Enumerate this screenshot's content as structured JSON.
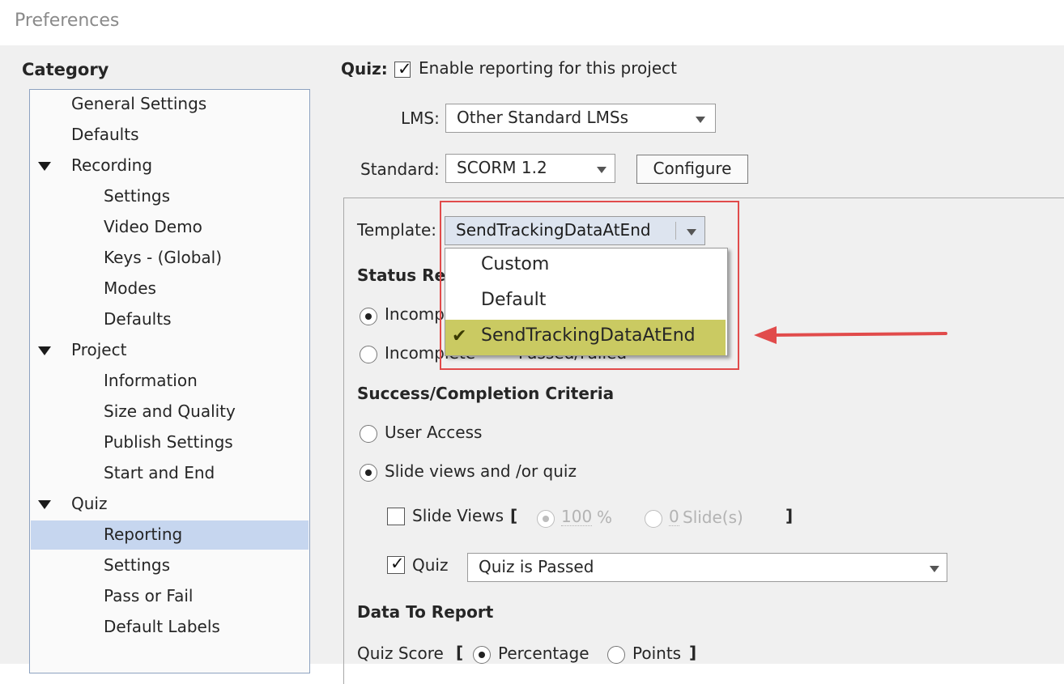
{
  "window": {
    "title": "Preferences"
  },
  "category": {
    "heading": "Category",
    "items": [
      {
        "label": "General Settings",
        "level": 0,
        "expandable": false,
        "selected": false
      },
      {
        "label": "Defaults",
        "level": 0,
        "expandable": false,
        "selected": false
      },
      {
        "label": "Recording",
        "level": 0,
        "expandable": true,
        "selected": false
      },
      {
        "label": "Settings",
        "level": 1,
        "expandable": false,
        "selected": false
      },
      {
        "label": "Video Demo",
        "level": 1,
        "expandable": false,
        "selected": false
      },
      {
        "label": "Keys - (Global)",
        "level": 1,
        "expandable": false,
        "selected": false
      },
      {
        "label": "Modes",
        "level": 1,
        "expandable": false,
        "selected": false
      },
      {
        "label": "Defaults",
        "level": 1,
        "expandable": false,
        "selected": false
      },
      {
        "label": "Project",
        "level": 0,
        "expandable": true,
        "selected": false
      },
      {
        "label": "Information",
        "level": 1,
        "expandable": false,
        "selected": false
      },
      {
        "label": "Size and Quality",
        "level": 1,
        "expandable": false,
        "selected": false
      },
      {
        "label": "Publish Settings",
        "level": 1,
        "expandable": false,
        "selected": false
      },
      {
        "label": "Start and End",
        "level": 1,
        "expandable": false,
        "selected": false
      },
      {
        "label": "Quiz",
        "level": 0,
        "expandable": true,
        "selected": false
      },
      {
        "label": "Reporting",
        "level": 1,
        "expandable": false,
        "selected": true
      },
      {
        "label": "Settings",
        "level": 1,
        "expandable": false,
        "selected": false
      },
      {
        "label": "Pass or Fail",
        "level": 1,
        "expandable": false,
        "selected": false
      },
      {
        "label": "Default Labels",
        "level": 1,
        "expandable": false,
        "selected": false
      }
    ]
  },
  "reporting": {
    "quiz_label": "Quiz:",
    "enable_checked": true,
    "enable_label": "Enable reporting for this project",
    "lms_label": "LMS:",
    "lms_value": "Other Standard LMSs",
    "standard_label": "Standard:",
    "standard_value": "SCORM 1.2",
    "configure_label": "Configure",
    "template_label": "Template:",
    "template_value": "SendTrackingDataAtEnd",
    "template_options": [
      {
        "label": "Custom",
        "selected": false
      },
      {
        "label": "Default",
        "selected": false
      },
      {
        "label": "SendTrackingDataAtEnd",
        "selected": true
      }
    ],
    "status_heading_visible": "Status Re",
    "status_option1_visible": "Incomp",
    "status_option2_visible": "Incomplete",
    "status_option2_tail_visible": "Passed/Failed",
    "success_heading": "Success/Completion Criteria",
    "user_access_label": "User Access",
    "slide_views_quiz_label": "Slide views and /or quiz",
    "slide_views_label": "Slide Views",
    "bracket_open": "[",
    "bracket_close": "]",
    "percent_value": "100",
    "percent_unit": "%",
    "slides_value": "0",
    "slides_unit": "Slide(s)",
    "quiz_checkbox_label": "Quiz",
    "quiz_criteria_value": "Quiz is Passed",
    "data_heading": "Data To Report",
    "quiz_score_label": "Quiz Score",
    "percentage_label": "Percentage",
    "points_label": "Points"
  },
  "colors": {
    "selection_highlight": "#c6d6ef",
    "dropdown_selected": "#caca62",
    "annotation_red": "#e14b4b"
  }
}
